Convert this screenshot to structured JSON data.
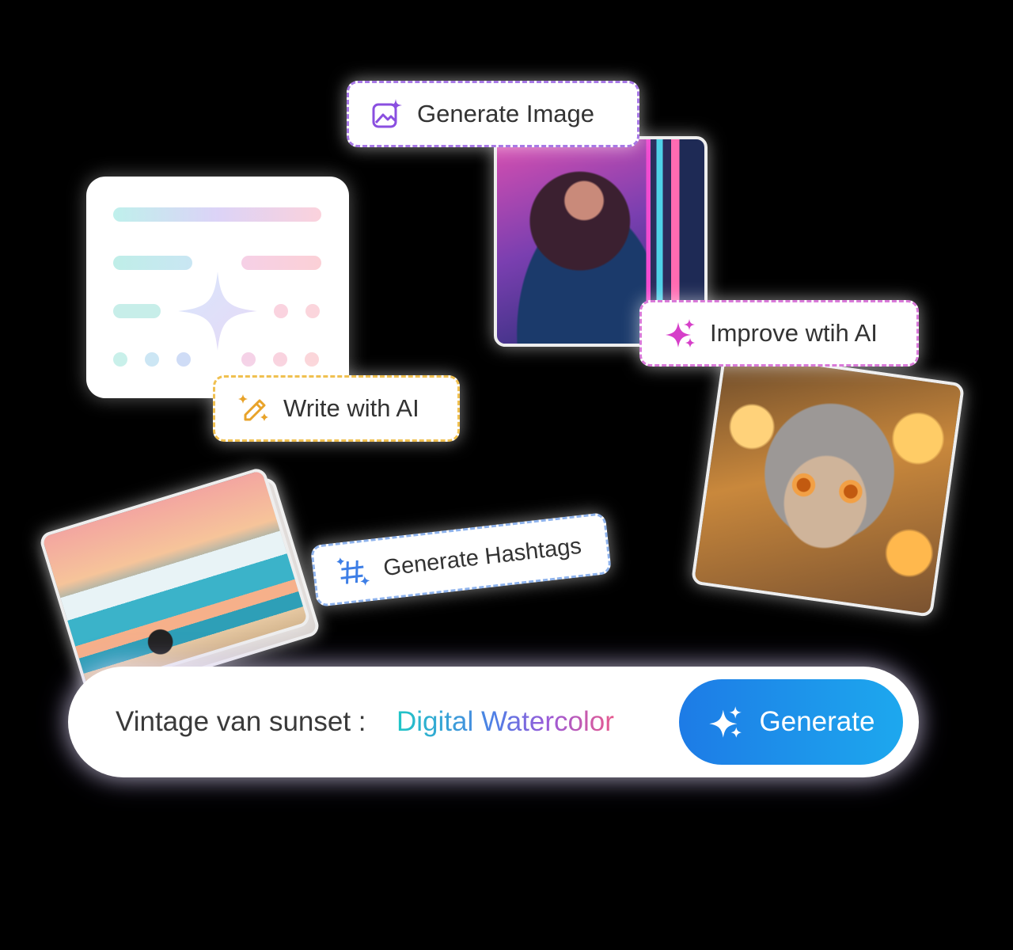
{
  "chips": {
    "generate_image": "Generate Image",
    "improve_ai": "Improve wtih AI",
    "write_ai": "Write with AI",
    "generate_hashtags": "Generate Hashtags"
  },
  "prompt": {
    "text": "Vintage van sunset :",
    "style": "Digital Watercolor",
    "button_label": "Generate"
  },
  "icons": {
    "generate_image": "image-sparkle-icon",
    "improve_ai": "sparkles-icon",
    "write_ai": "magic-pencil-icon",
    "generate_hashtags": "hashtag-sparkle-icon",
    "generate_button": "sparkles-icon"
  },
  "colors": {
    "background": "#000000",
    "button_start": "#1d7be6",
    "button_end": "#1da8ee",
    "generate_image_accent": "#8a4fe0",
    "improve_ai_accent": "#d63fc9",
    "write_ai_accent": "#e8a32a",
    "hashtags_accent": "#3d7ee6"
  }
}
